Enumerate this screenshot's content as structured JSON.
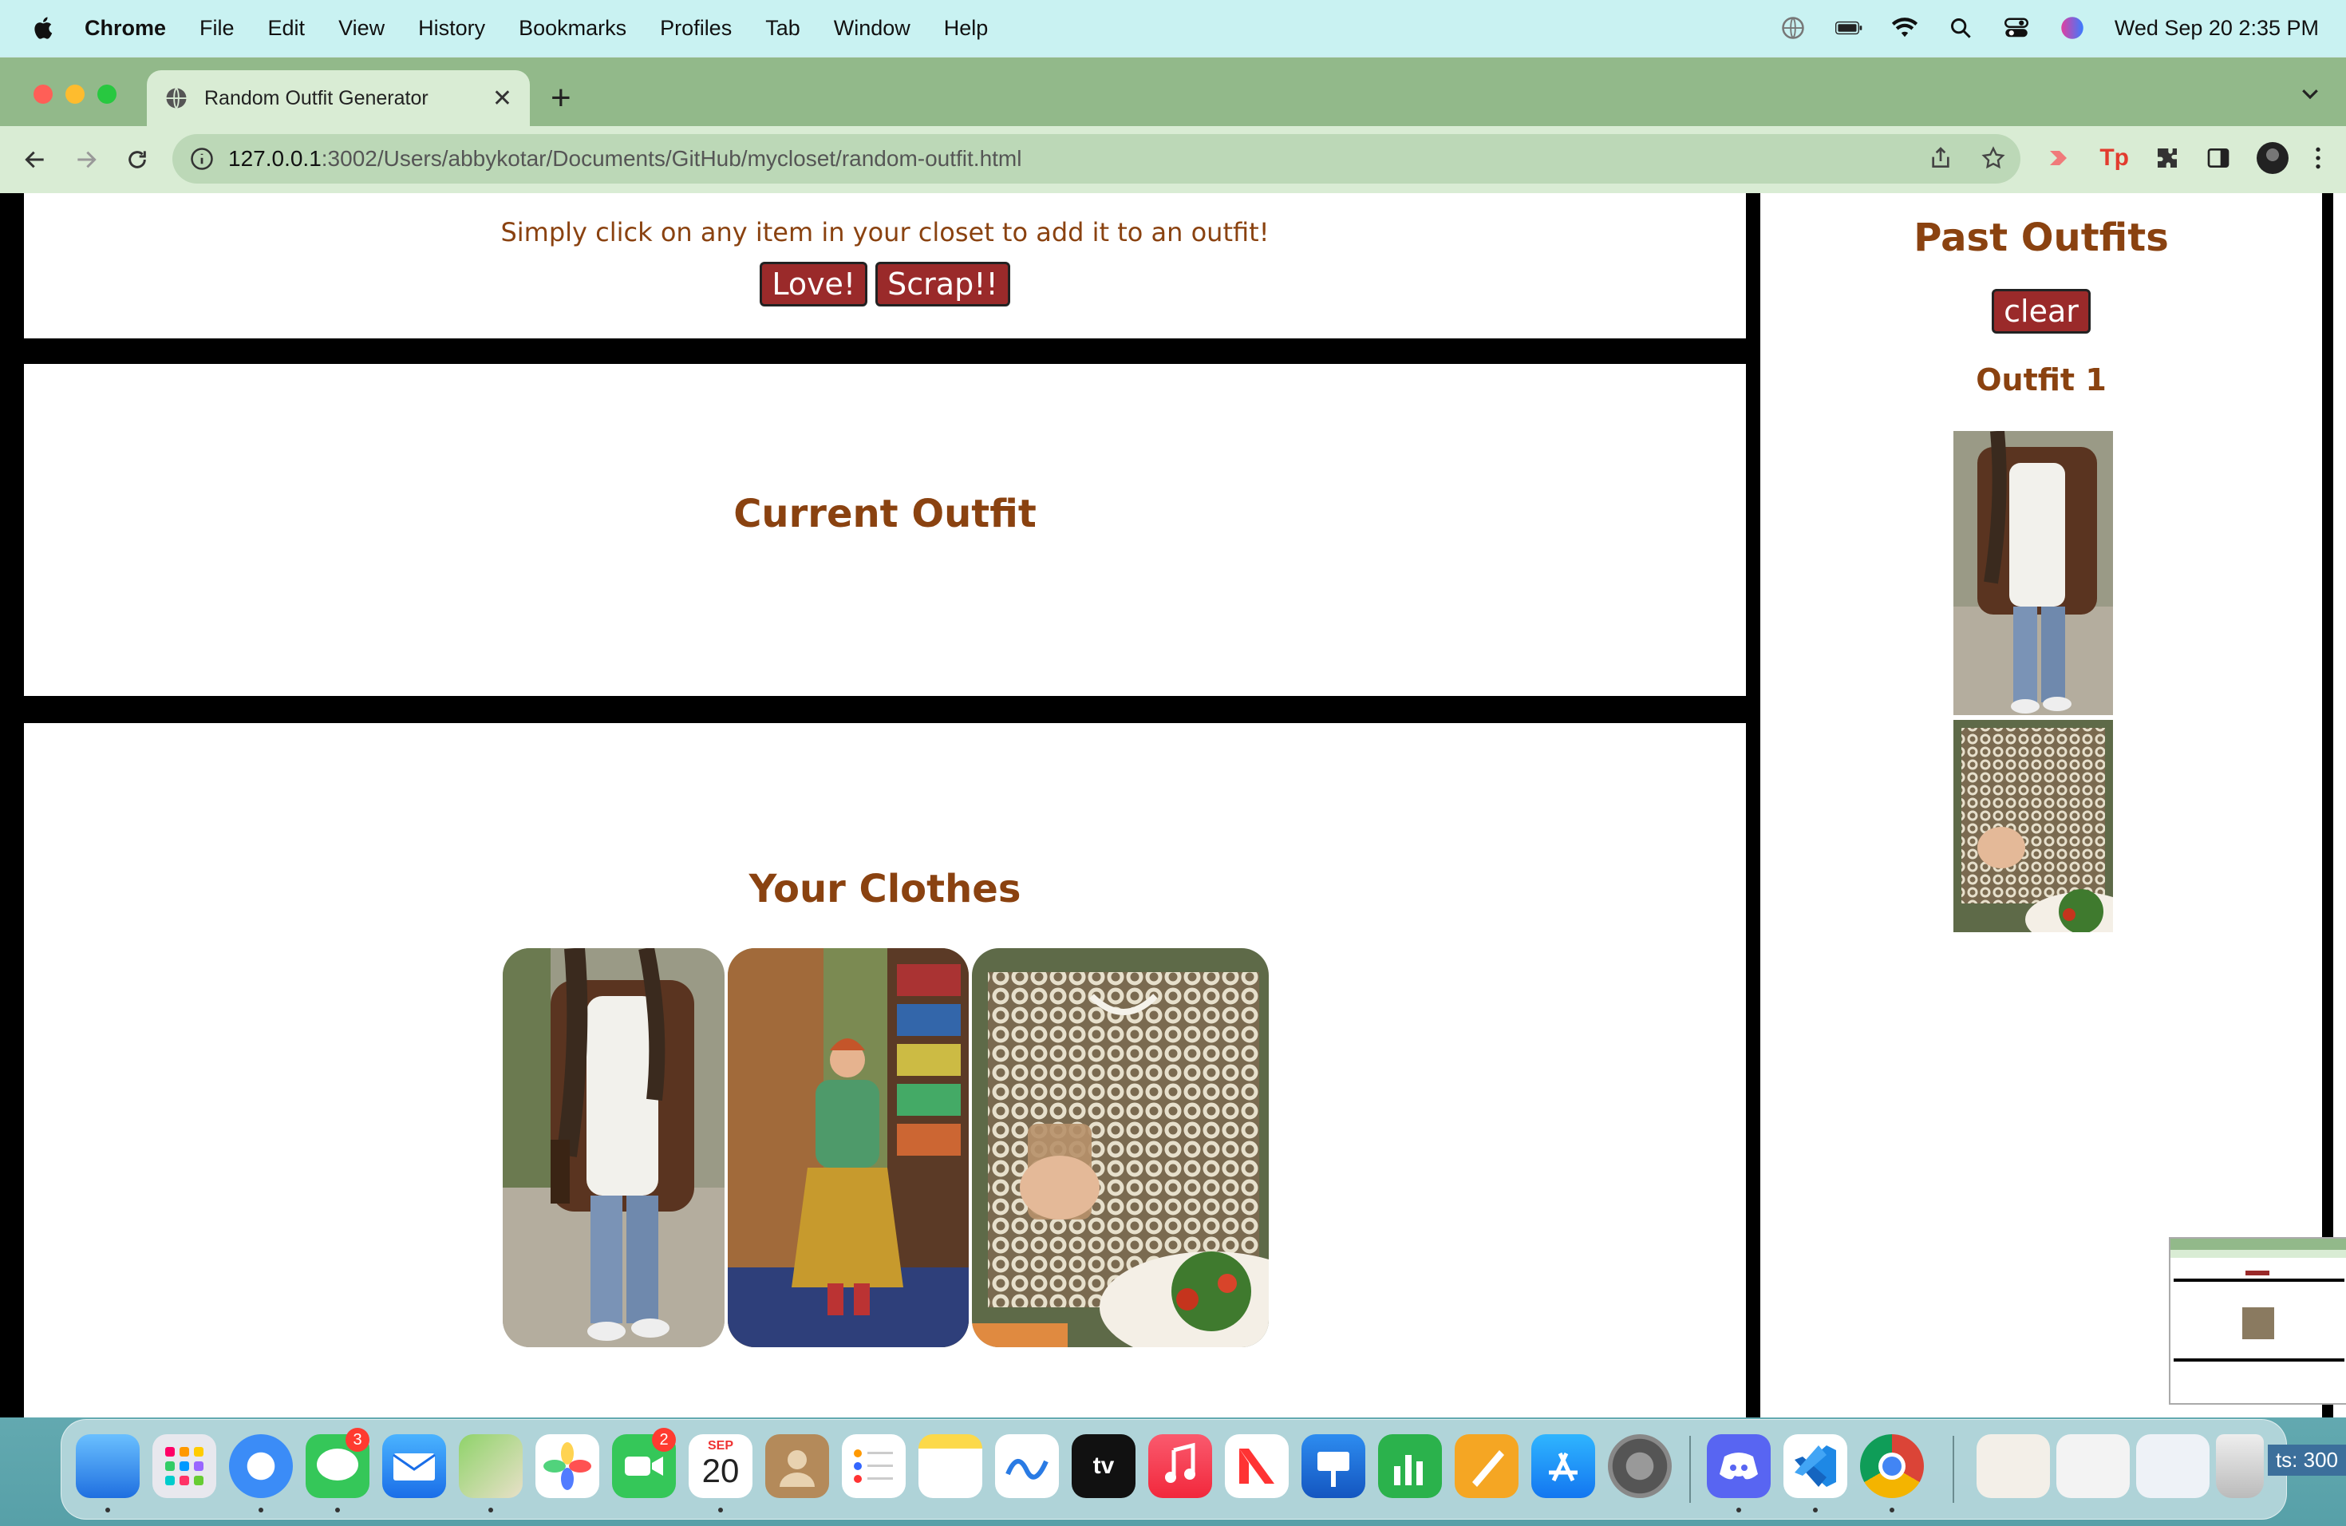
{
  "menubar": {
    "app_name": "Chrome",
    "items": [
      "File",
      "Edit",
      "View",
      "History",
      "Bookmarks",
      "Profiles",
      "Tab",
      "Window",
      "Help"
    ],
    "clock": "Wed Sep 20  2:35 PM",
    "status_icons": [
      "globe-icon",
      "battery-icon",
      "wifi-icon",
      "search-icon",
      "control-center-icon",
      "siri-icon"
    ]
  },
  "browser": {
    "tab_title": "Random Outfit Generator",
    "url_host": "127.0.0.1",
    "url_path": ":3002/Users/abbykotar/Documents/GitHub/mycloset/random-outfit.html",
    "theme_colors": {
      "tabstrip": "#92b98a",
      "toolbar": "#d9ecd4",
      "omnibox": "#bcd8b7"
    }
  },
  "page": {
    "instructions": "Simply click on any item in your closet to add it to an outfit!",
    "love_button": "Love!",
    "scrap_button": "Scrap!!",
    "current_outfit_heading": "Current Outfit",
    "your_clothes_heading": "Your Clothes",
    "clothes": [
      {
        "name": "brown cardigan outfit photo"
      },
      {
        "name": "green sweater and yellow skirt photo"
      },
      {
        "name": "crochet mesh top photo"
      }
    ],
    "past_outfits_heading": "Past Outfits",
    "clear_button": "clear",
    "past_outfits": [
      {
        "label": "Outfit 1",
        "items": [
          "brown cardigan outfit photo",
          "crochet mesh top photo"
        ]
      }
    ],
    "colors": {
      "heading_brown": "#8a4210",
      "button_red": "#9a2a2a",
      "border_black": "#000000"
    }
  },
  "dock": {
    "apps": [
      "Finder",
      "Launchpad",
      "Safari",
      "Messages",
      "Mail",
      "Maps",
      "Photos",
      "FaceTime",
      "Calendar",
      "Contacts",
      "Reminders",
      "Notes",
      "Freeform",
      "TV",
      "Music",
      "News",
      "Keynote",
      "Numbers",
      "Pages",
      "App Store",
      "System Settings",
      "Discord",
      "Visual Studio Code",
      "Google Chrome"
    ],
    "messages_badge": "3",
    "facetime_badge": "2",
    "calendar_month": "SEP",
    "calendar_day": "20",
    "tv_label": "tv",
    "corner_text": "ts: 300"
  }
}
